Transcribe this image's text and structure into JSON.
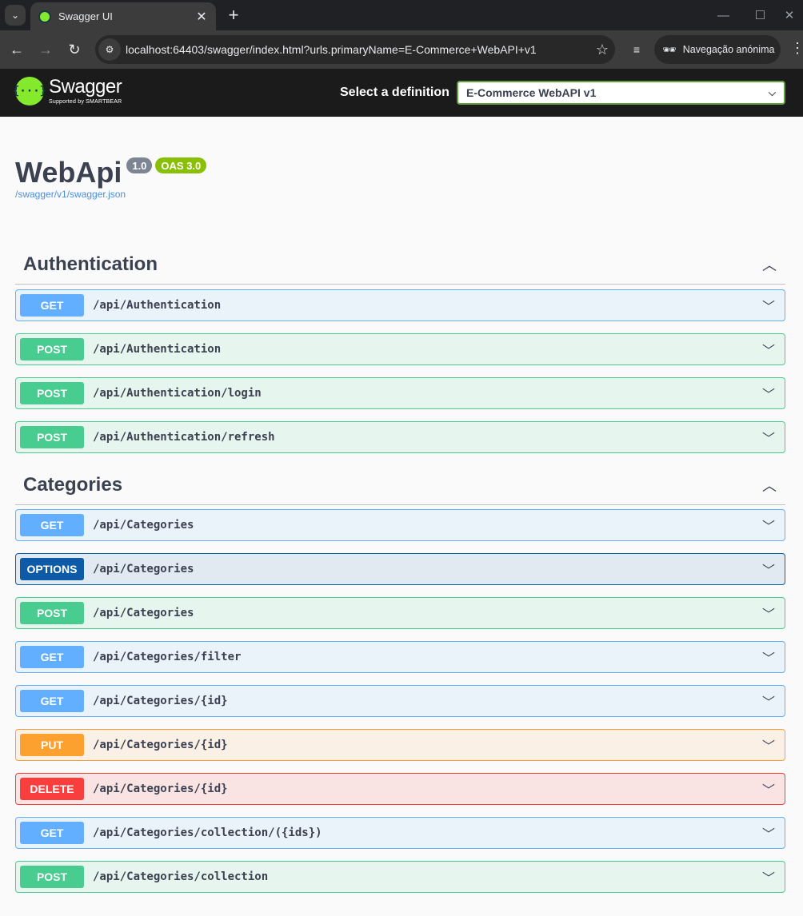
{
  "browser": {
    "tab_title": "Swagger UI",
    "tab_close": "✕",
    "new_tab": "+",
    "url": "localhost:64403/swagger/index.html?urls.primaryName=E-Commerce+WebAPI+v1",
    "incognito_label": "Navegação anónima"
  },
  "topbar": {
    "logo_name": "Swagger",
    "logo_sub": "Supported by SMARTBEAR",
    "logo_glyph": "{···}",
    "select_label": "Select a definition",
    "selected_definition": "E-Commerce WebAPI v1"
  },
  "info": {
    "title": "WebApi",
    "version": "1.0",
    "oas": "OAS 3.0",
    "spec_url": "/swagger/v1/swagger.json"
  },
  "sections": [
    {
      "name": "Authentication",
      "operations": [
        {
          "method": "GET",
          "path": "/api/Authentication"
        },
        {
          "method": "POST",
          "path": "/api/Authentication"
        },
        {
          "method": "POST",
          "path": "/api/Authentication/login"
        },
        {
          "method": "POST",
          "path": "/api/Authentication/refresh"
        }
      ]
    },
    {
      "name": "Categories",
      "operations": [
        {
          "method": "GET",
          "path": "/api/Categories"
        },
        {
          "method": "OPTIONS",
          "path": "/api/Categories"
        },
        {
          "method": "POST",
          "path": "/api/Categories"
        },
        {
          "method": "GET",
          "path": "/api/Categories/filter"
        },
        {
          "method": "GET",
          "path": "/api/Categories/{id}"
        },
        {
          "method": "PUT",
          "path": "/api/Categories/{id}"
        },
        {
          "method": "DELETE",
          "path": "/api/Categories/{id}"
        },
        {
          "method": "GET",
          "path": "/api/Categories/collection/({ids})"
        },
        {
          "method": "POST",
          "path": "/api/Categories/collection"
        }
      ]
    }
  ],
  "colors": {
    "get": "#61affe",
    "post": "#49cc90",
    "put": "#fca130",
    "delete": "#f93e3e",
    "options": "#0d5aa7",
    "swagger_green": "#85ea2d"
  }
}
